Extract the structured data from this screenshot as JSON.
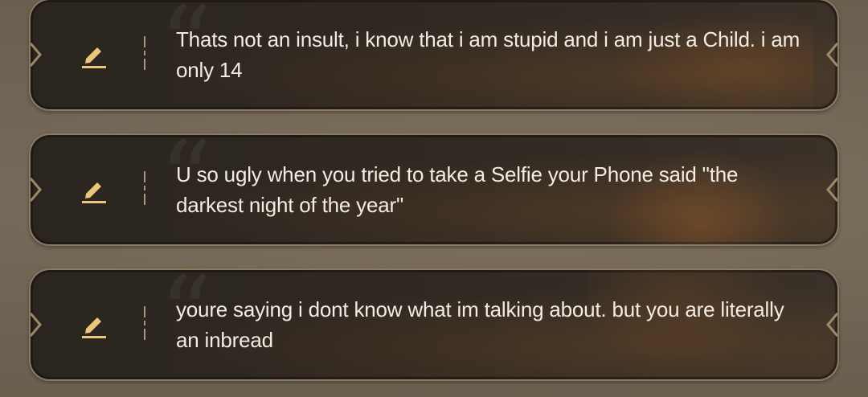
{
  "messages": [
    {
      "text": "Thats not an insult, i know that i am stupid and i am just a Child. i am only 14"
    },
    {
      "text": "U so ugly when you tried to take a Selfie your Phone said \"the darkest night of the year\""
    },
    {
      "text": "youre saying i dont know what im talking about. but you are literally an inbread"
    }
  ],
  "icons": {
    "edit": "pencil-icon",
    "left_chevron": "chevron-right-icon",
    "right_chevron": "chevron-left-icon"
  },
  "colors": {
    "accent": "#e9c87a",
    "text": "#f2ece2",
    "card_border": "#8a7a60"
  }
}
